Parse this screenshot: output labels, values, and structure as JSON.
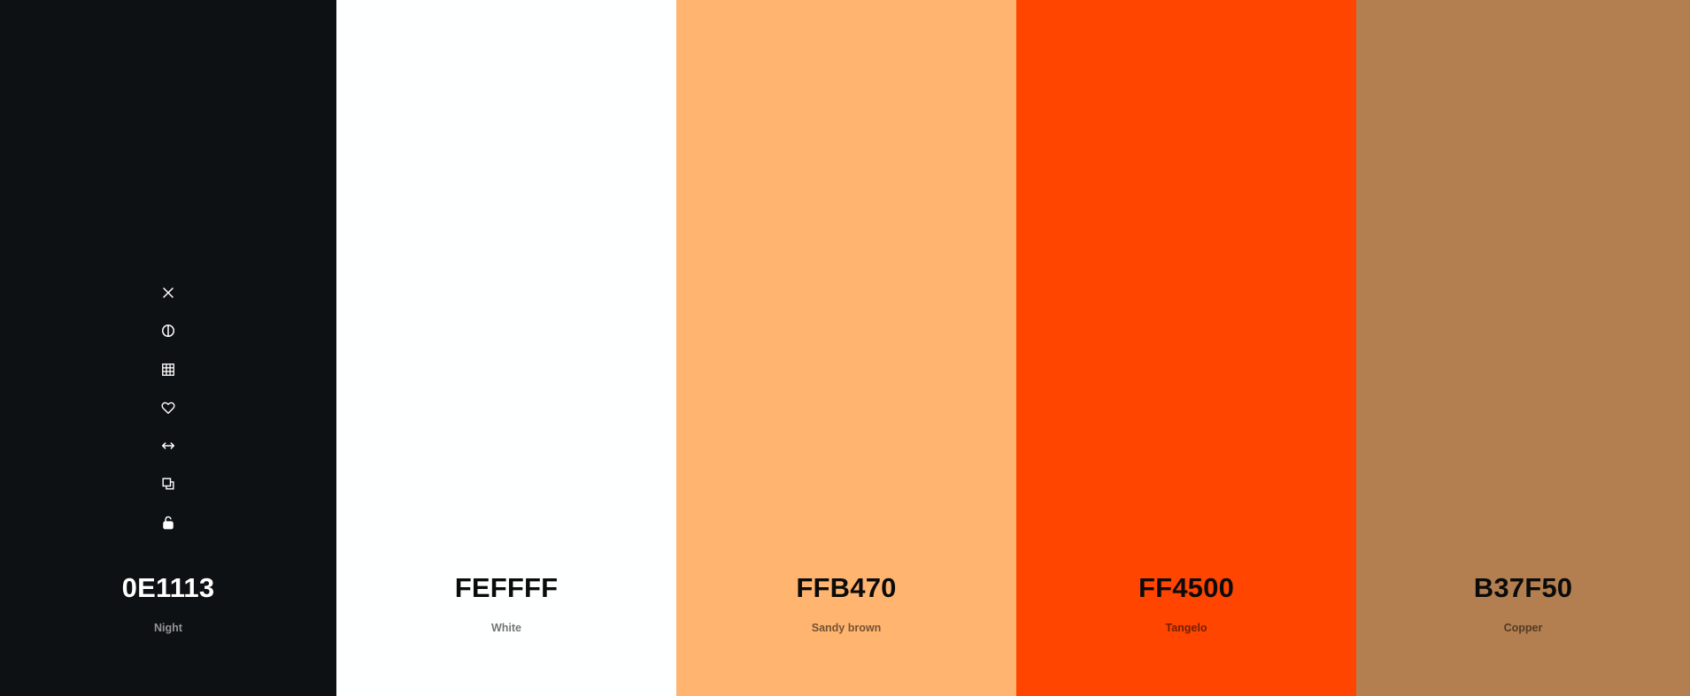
{
  "palette": {
    "colors": [
      {
        "hex": "0E1113",
        "name": "Night",
        "value": "#0E1113"
      },
      {
        "hex": "FEFFFF",
        "name": "White",
        "value": "#FEFFFF"
      },
      {
        "hex": "FFB470",
        "name": "Sandy brown",
        "value": "#FFB470"
      },
      {
        "hex": "FF4500",
        "name": "Tangelo",
        "value": "#FF4500"
      },
      {
        "hex": "B37F50",
        "name": "Copper",
        "value": "#B37F50"
      }
    ]
  },
  "toolbar": {
    "icons": [
      "close-icon",
      "contrast-icon",
      "shades-icon",
      "heart-icon",
      "drag-icon",
      "copy-icon",
      "unlock-icon"
    ]
  }
}
